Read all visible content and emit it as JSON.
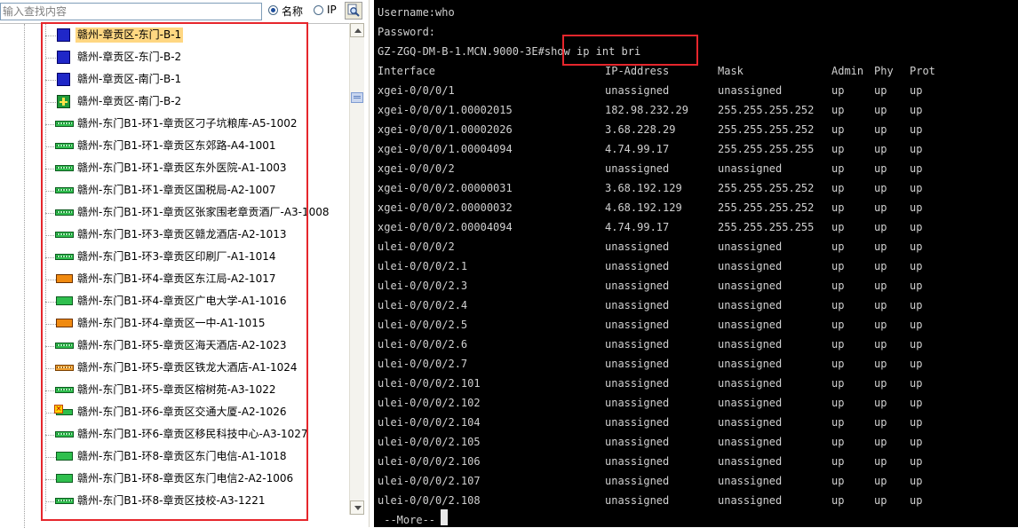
{
  "search": {
    "placeholder": "输入查找内容",
    "value": ""
  },
  "search_mode": {
    "options": [
      "名称",
      "IP"
    ],
    "selected": "名称"
  },
  "icons": {
    "search_button": "magnifier-icon",
    "tree_up": "chevron-up-icon",
    "tree_down": "chevron-down-icon"
  },
  "tree": {
    "selected_index": 0,
    "nodes": [
      {
        "label": "赣州-章贡区-东门-B-1",
        "icon": "blue-router"
      },
      {
        "label": "赣州-章贡区-东门-B-2",
        "icon": "blue-router"
      },
      {
        "label": "赣州-章贡区-南门-B-1",
        "icon": "blue-router"
      },
      {
        "label": "赣州-章贡区-南门-B-2",
        "icon": "green-chip"
      },
      {
        "label": "赣州-东门B1-环1-章贡区刁子坑粮库-A5-1002",
        "icon": "green-bar"
      },
      {
        "label": "赣州-东门B1-环1-章贡区东郊路-A4-1001",
        "icon": "green-bar"
      },
      {
        "label": "赣州-东门B1-环1-章贡区东外医院-A1-1003",
        "icon": "green-bar"
      },
      {
        "label": "赣州-东门B1-环1-章贡区国税局-A2-1007",
        "icon": "green-bar"
      },
      {
        "label": "赣州-东门B1-环1-章贡区张家围老章贡酒厂-A3-1008",
        "icon": "green-bar"
      },
      {
        "label": "赣州-东门B1-环3-章贡区赣龙酒店-A2-1013",
        "icon": "green-bar"
      },
      {
        "label": "赣州-东门B1-环3-章贡区印刷厂-A1-1014",
        "icon": "green-bar"
      },
      {
        "label": "赣州-东门B1-环4-章贡区东江局-A2-1017",
        "icon": "orange-box"
      },
      {
        "label": "赣州-东门B1-环4-章贡区广电大学-A1-1016",
        "icon": "green-box"
      },
      {
        "label": "赣州-东门B1-环4-章贡区一中-A1-1015",
        "icon": "orange-box"
      },
      {
        "label": "赣州-东门B1-环5-章贡区海天酒店-A2-1023",
        "icon": "green-bar"
      },
      {
        "label": "赣州-东门B1-环5-章贡区铁龙大酒店-A1-1024",
        "icon": "orange-bar"
      },
      {
        "label": "赣州-东门B1-环5-章贡区榕树苑-A3-1022",
        "icon": "green-bar"
      },
      {
        "label": "赣州-东门B1-环6-章贡区交通大厦-A2-1026",
        "icon": "alarm"
      },
      {
        "label": "赣州-东门B1-环6-章贡区移民科技中心-A3-1027",
        "icon": "green-bar"
      },
      {
        "label": "赣州-东门B1-环8-章贡区东门电信-A1-1018",
        "icon": "green-box"
      },
      {
        "label": "赣州-东门B1-环8-章贡区东门电信2-A2-1006",
        "icon": "green-box"
      },
      {
        "label": "赣州-东门B1-环8-章贡区技校-A3-1221",
        "icon": "green-bar"
      }
    ]
  },
  "terminal": {
    "username_line": "Username:who",
    "password_line": "Password:",
    "prompt": "GZ-ZGQ-DM-B-1.MCN.9000-3E#",
    "command": "show ip int bri",
    "headers": [
      "Interface",
      "IP-Address",
      "Mask",
      "Admin",
      "Phy",
      "Prot"
    ],
    "rows": [
      [
        "xgei-0/0/0/1",
        "unassigned",
        "unassigned",
        "up",
        "up",
        "up"
      ],
      [
        "xgei-0/0/0/1.00002015",
        "182.98.232.29",
        "255.255.255.252",
        "up",
        "up",
        "up"
      ],
      [
        "xgei-0/0/0/1.00002026",
        "3.68.228.29",
        "255.255.255.252",
        "up",
        "up",
        "up"
      ],
      [
        "xgei-0/0/0/1.00004094",
        "4.74.99.17",
        "255.255.255.255",
        "up",
        "up",
        "up"
      ],
      [
        "xgei-0/0/0/2",
        "unassigned",
        "unassigned",
        "up",
        "up",
        "up"
      ],
      [
        "xgei-0/0/0/2.00000031",
        "3.68.192.129",
        "255.255.255.252",
        "up",
        "up",
        "up"
      ],
      [
        "xgei-0/0/0/2.00000032",
        "4.68.192.129",
        "255.255.255.252",
        "up",
        "up",
        "up"
      ],
      [
        "xgei-0/0/0/2.00004094",
        "4.74.99.17",
        "255.255.255.255",
        "up",
        "up",
        "up"
      ],
      [
        "ulei-0/0/0/2",
        "unassigned",
        "unassigned",
        "up",
        "up",
        "up"
      ],
      [
        "ulei-0/0/0/2.1",
        "unassigned",
        "unassigned",
        "up",
        "up",
        "up"
      ],
      [
        "ulei-0/0/0/2.3",
        "unassigned",
        "unassigned",
        "up",
        "up",
        "up"
      ],
      [
        "ulei-0/0/0/2.4",
        "unassigned",
        "unassigned",
        "up",
        "up",
        "up"
      ],
      [
        "ulei-0/0/0/2.5",
        "unassigned",
        "unassigned",
        "up",
        "up",
        "up"
      ],
      [
        "ulei-0/0/0/2.6",
        "unassigned",
        "unassigned",
        "up",
        "up",
        "up"
      ],
      [
        "ulei-0/0/0/2.7",
        "unassigned",
        "unassigned",
        "up",
        "up",
        "up"
      ],
      [
        "ulei-0/0/0/2.101",
        "unassigned",
        "unassigned",
        "up",
        "up",
        "up"
      ],
      [
        "ulei-0/0/0/2.102",
        "unassigned",
        "unassigned",
        "up",
        "up",
        "up"
      ],
      [
        "ulei-0/0/0/2.104",
        "unassigned",
        "unassigned",
        "up",
        "up",
        "up"
      ],
      [
        "ulei-0/0/0/2.105",
        "unassigned",
        "unassigned",
        "up",
        "up",
        "up"
      ],
      [
        "ulei-0/0/0/2.106",
        "unassigned",
        "unassigned",
        "up",
        "up",
        "up"
      ],
      [
        "ulei-0/0/0/2.107",
        "unassigned",
        "unassigned",
        "up",
        "up",
        "up"
      ],
      [
        "ulei-0/0/0/2.108",
        "unassigned",
        "unassigned",
        "up",
        "up",
        "up"
      ]
    ],
    "more_prompt": " --More--"
  },
  "colors": {
    "highlight_frame": "#e6262c",
    "selected_node": "#ffd782",
    "terminal_bg": "#000000",
    "terminal_text": "#d0d0d0"
  }
}
